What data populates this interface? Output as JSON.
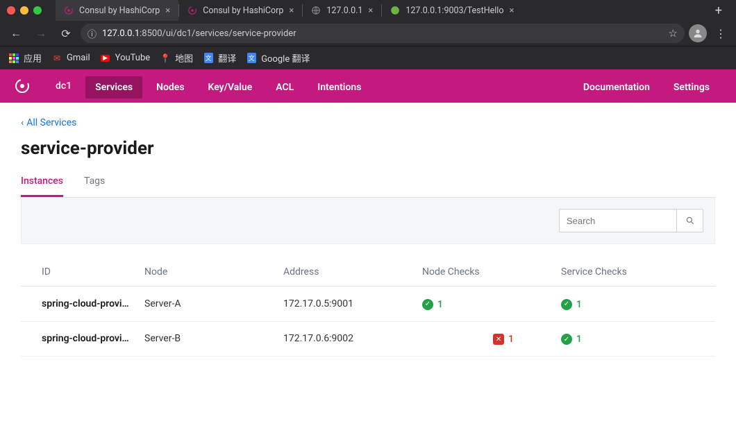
{
  "browser": {
    "tabs": [
      {
        "title": "Consul by HashiCorp",
        "favicon": "consul",
        "active": true
      },
      {
        "title": "Consul by HashiCorp",
        "favicon": "consul",
        "active": false
      },
      {
        "title": "127.0.0.1",
        "favicon": "globe",
        "active": false
      },
      {
        "title": "127.0.0.1:9003/TestHello",
        "favicon": "spring",
        "active": false
      }
    ],
    "url_host": "127.0.0.1",
    "url_port": ":8500",
    "url_path": "/ui/dc1/services/service-provider",
    "bookmarks": [
      {
        "label": "应用",
        "icon": "apps"
      },
      {
        "label": "Gmail",
        "icon": "gmail"
      },
      {
        "label": "YouTube",
        "icon": "youtube"
      },
      {
        "label": "地图",
        "icon": "maps"
      },
      {
        "label": "翻译",
        "icon": "translate"
      },
      {
        "label": "Google 翻译",
        "icon": "translate"
      }
    ]
  },
  "nav": {
    "dc": "dc1",
    "items": [
      "Services",
      "Nodes",
      "Key/Value",
      "ACL",
      "Intentions"
    ],
    "active": "Services",
    "right": [
      "Documentation",
      "Settings"
    ]
  },
  "page": {
    "backlink": "All Services",
    "title": "service-provider",
    "subtabs": [
      "Instances",
      "Tags"
    ],
    "active_subtab": "Instances",
    "search_placeholder": "Search"
  },
  "table": {
    "headers": [
      "ID",
      "Node",
      "Address",
      "Node Checks",
      "Service Checks"
    ],
    "rows": [
      {
        "id": "spring-cloud-provide...",
        "node": "Server-A",
        "address": "172.17.0.5:9001",
        "node_checks": {
          "status": "pass",
          "count": "1"
        },
        "service_checks": {
          "status": "pass",
          "count": "1"
        }
      },
      {
        "id": "spring-cloud-provide...",
        "node": "Server-B",
        "address": "172.17.0.6:9002",
        "node_checks": {
          "status": "crit",
          "count": "1"
        },
        "service_checks": {
          "status": "pass",
          "count": "1"
        }
      }
    ]
  }
}
